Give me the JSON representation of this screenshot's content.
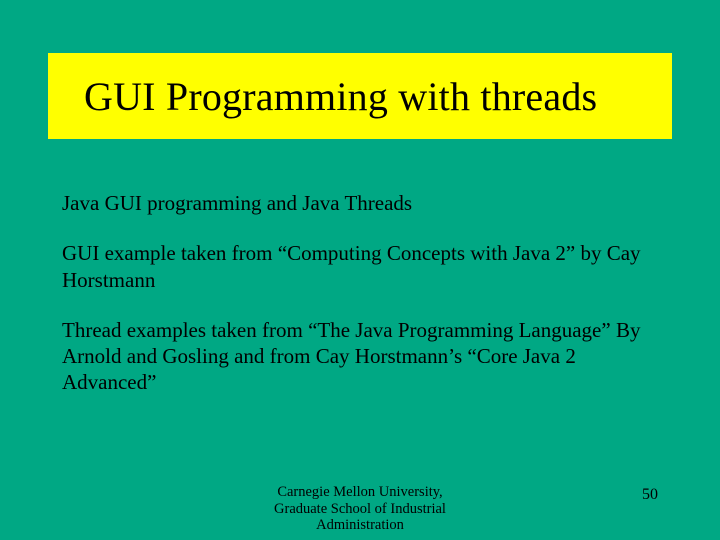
{
  "title": "GUI Programming with threads",
  "paragraphs": {
    "p1": "Java GUI programming and Java Threads",
    "p2": "GUI example taken from “Computing Concepts with Java 2” by Cay Horstmann",
    "p3": "Thread examples taken from “The Java Programming Language” By Arnold and Gosling and from Cay Horstmann’s “Core Java 2 Advanced”"
  },
  "footer": {
    "line1": "Carnegie Mellon University,",
    "line2": "Graduate School of Industrial",
    "line3": "Administration",
    "page": "50"
  }
}
